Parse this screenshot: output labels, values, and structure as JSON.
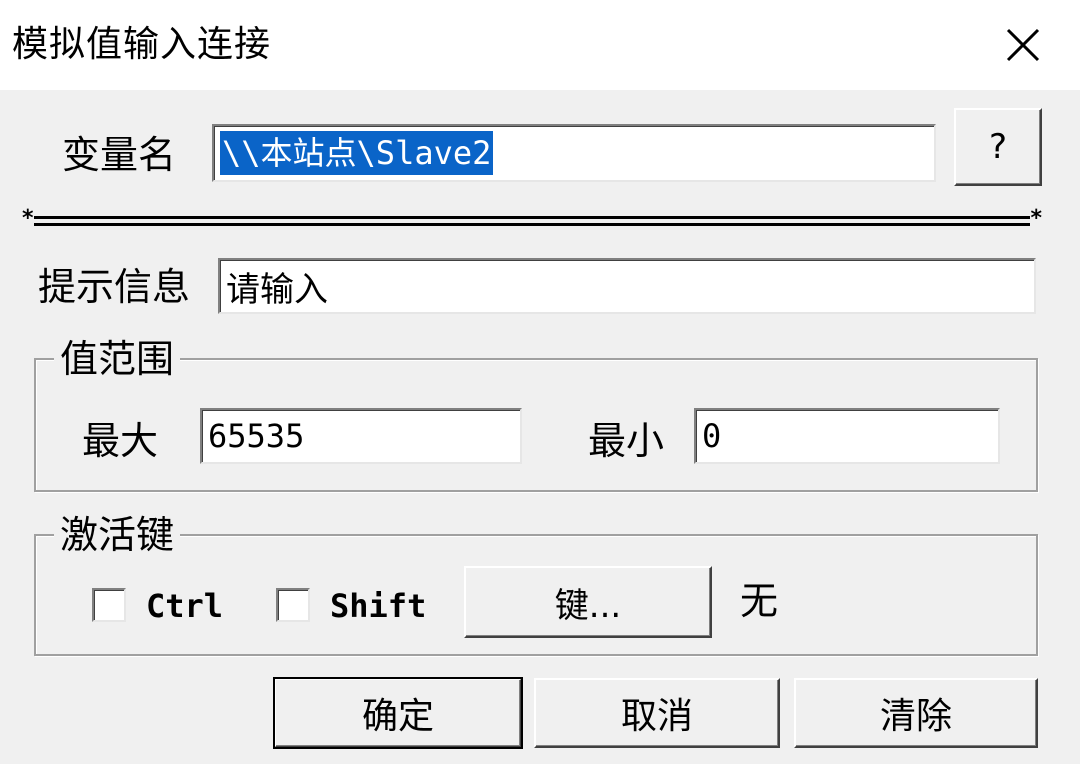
{
  "window": {
    "title": "模拟值输入连接",
    "close_glyph": "✕"
  },
  "variable": {
    "label": "变量名",
    "value": "\\\\本站点\\Slave2",
    "help_label": "?"
  },
  "prompt": {
    "label": "提示信息",
    "value": "请输入"
  },
  "range": {
    "group_label": "值范围",
    "max_label": "最大",
    "max_value": "65535",
    "min_label": "最小",
    "min_value": "0"
  },
  "hotkey": {
    "group_label": "激活键",
    "ctrl_label": "Ctrl",
    "ctrl_checked": false,
    "shift_label": "Shift",
    "shift_checked": false,
    "key_button_label": "键...",
    "key_value": "无"
  },
  "buttons": {
    "ok_label": "确定",
    "cancel_label": "取消",
    "clear_label": "清除"
  },
  "colors": {
    "selection": "#0a64c8",
    "dialog_bg": "#f0f0f0",
    "titlebar_bg": "#ffffff"
  }
}
